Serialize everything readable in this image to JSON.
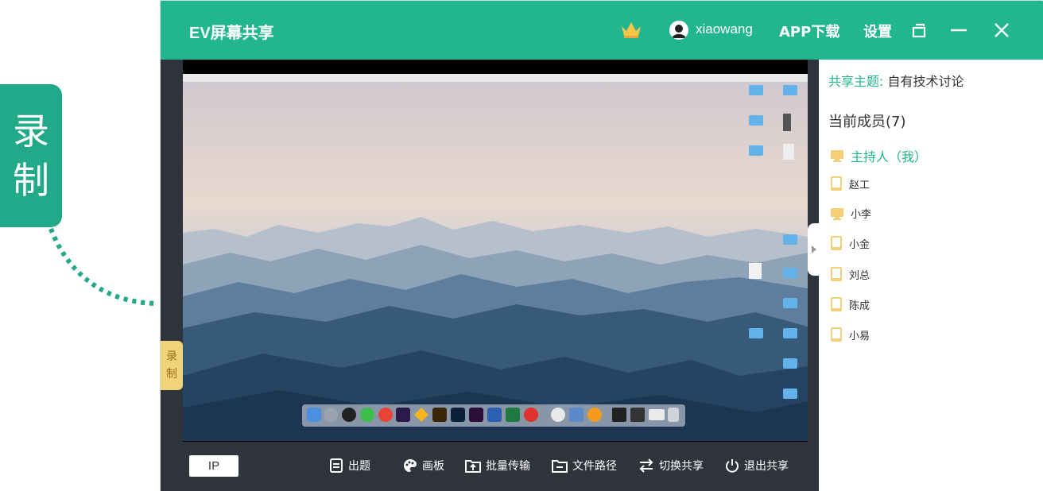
{
  "callout": {
    "line1": "录",
    "line2": "制"
  },
  "titlebar": {
    "app_title": "EV屏幕共享",
    "username": "xiaowang",
    "app_download": "APP下载",
    "settings": "设置"
  },
  "record_tab": {
    "line1": "录",
    "line2": "制"
  },
  "toolbar": {
    "ip": "IP",
    "items": [
      {
        "label": "出题",
        "icon": "document-icon"
      },
      {
        "label": "画板",
        "icon": "palette-icon"
      },
      {
        "label": "批量传输",
        "icon": "upload-folder-icon"
      },
      {
        "label": "文件路径",
        "icon": "folder-icon"
      },
      {
        "label": "切换共享",
        "icon": "switch-icon"
      },
      {
        "label": "退出共享",
        "icon": "power-icon"
      }
    ]
  },
  "panel": {
    "topic_label": "共享主题:",
    "topic_value": "自有技术讨论",
    "members_title": "当前成员(7)",
    "members": [
      {
        "name": "主持人（我）",
        "role": "host",
        "device": "desktop"
      },
      {
        "name": "赵工",
        "device": "phone"
      },
      {
        "name": "小李",
        "device": "desktop"
      },
      {
        "name": "小金",
        "device": "phone"
      },
      {
        "name": "刘总",
        "device": "phone"
      },
      {
        "name": "陈成",
        "device": "phone"
      },
      {
        "name": "小易",
        "device": "phone"
      }
    ]
  },
  "colors": {
    "brand": "#21b68d",
    "toolbar": "#2f333b",
    "record": "#f1d47a"
  }
}
